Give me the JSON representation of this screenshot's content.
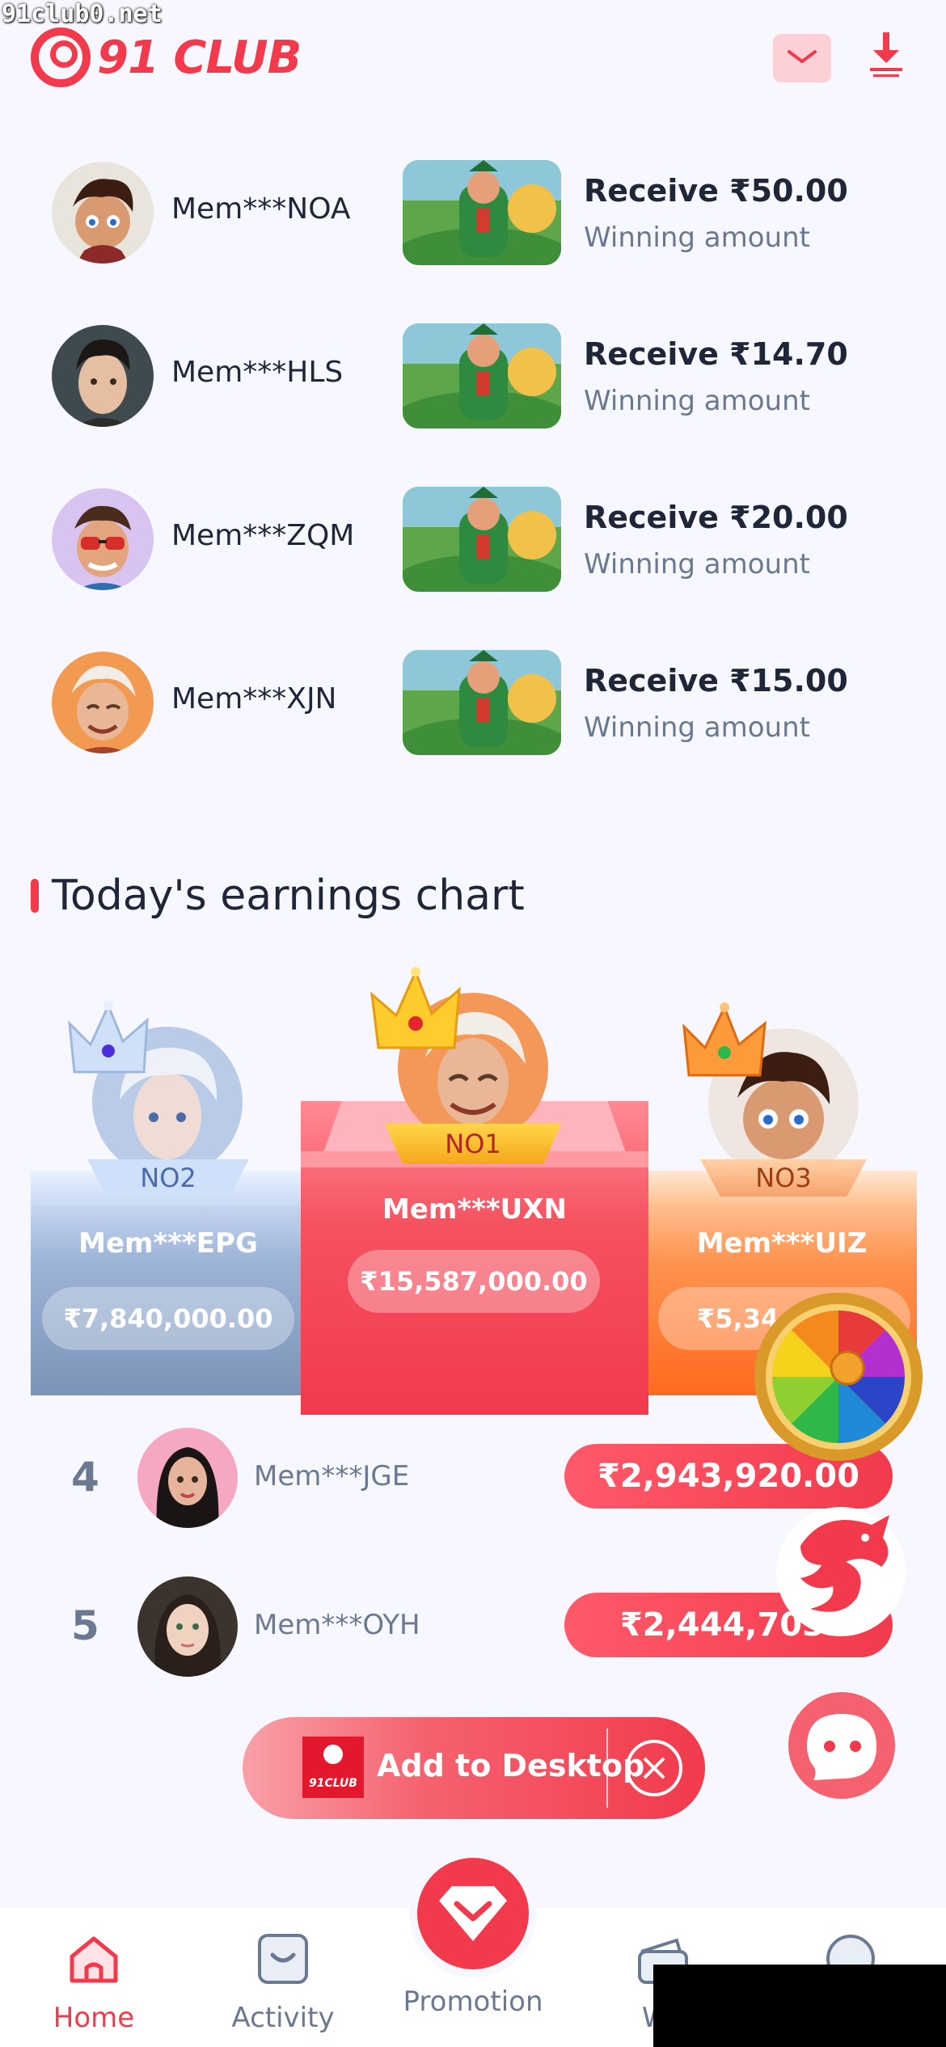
{
  "watermark": "91club0.net",
  "header": {
    "logo_text": "91 CLUB",
    "mail_icon": "mail-icon",
    "download_icon": "download-icon"
  },
  "winners": [
    {
      "name": "Mem***NOA",
      "receive": "Receive ₹50.00",
      "sub": "Winning amount"
    },
    {
      "name": "Mem***HLS",
      "receive": "Receive ₹14.70",
      "sub": "Winning amount"
    },
    {
      "name": "Mem***ZQM",
      "receive": "Receive ₹20.00",
      "sub": "Winning amount"
    },
    {
      "name": "Mem***XJN",
      "receive": "Receive ₹15.00",
      "sub": "Winning amount"
    }
  ],
  "chart_section": {
    "title": "Today's earnings chart",
    "podium": {
      "first": {
        "badge": "NO1",
        "name": "Mem***UXN",
        "amount": "₹15,587,000.00"
      },
      "second": {
        "badge": "NO2",
        "name": "Mem***EPG",
        "amount": "₹7,840,000.00"
      },
      "third": {
        "badge": "NO3",
        "name": "Mem***UIZ",
        "amount": "₹5,34"
      }
    },
    "ranks": [
      {
        "rank": "4",
        "name": "Mem***JGE",
        "amount": "₹2,943,920.00"
      },
      {
        "rank": "5",
        "name": "Mem***OYH",
        "amount": "₹2,444,703."
      }
    ]
  },
  "add_to_desktop": {
    "logo_text": "91CLUB",
    "label": "Add to Desktop"
  },
  "nav": {
    "home": "Home",
    "activity": "Activity",
    "promotion": "Promotion",
    "wallet": "Wa",
    "account": ""
  },
  "colors": {
    "brand": "#f23a4c",
    "text": "#1e2637",
    "muted": "#6b7990",
    "background": "#f7f8ff"
  }
}
